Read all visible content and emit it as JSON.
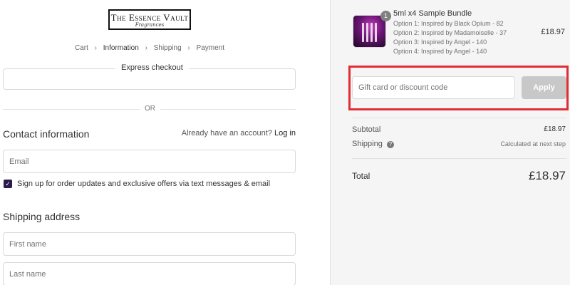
{
  "store": {
    "logo_title": "The Essence Vault",
    "logo_sub": "Fragrances"
  },
  "breadcrumb": {
    "items": [
      "Cart",
      "Information",
      "Shipping",
      "Payment"
    ],
    "current": "Information"
  },
  "express": {
    "label": "Express checkout"
  },
  "divider": {
    "or": "OR"
  },
  "contact": {
    "title": "Contact information",
    "account_prompt": "Already have an account?",
    "login_label": "Log in",
    "email_placeholder": "Email",
    "signup_label": "Sign up for order updates and exclusive offers via text messages & email",
    "signup_checked": true
  },
  "shipping": {
    "title": "Shipping address",
    "first_name_placeholder": "First name",
    "last_name_placeholder": "Last name"
  },
  "order": {
    "quantity": "1",
    "product_name": "5ml x4 Sample Bundle",
    "options": [
      "Option 1: Inspired by Black Opium - 82",
      "Option 2: Inspired by Madamoiselle - 37",
      "Option 3: Inspired by Angel - 140",
      "Option 4: Inspired by Angel - 140"
    ],
    "price": "£18.97"
  },
  "discount": {
    "placeholder": "Gift card or discount code",
    "apply_label": "Apply"
  },
  "summary": {
    "subtotal_label": "Subtotal",
    "subtotal_value": "£18.97",
    "shipping_label": "Shipping",
    "shipping_value": "Calculated at next step",
    "total_label": "Total",
    "total_value": "£18.97"
  },
  "colors": {
    "highlight": "#e02d36",
    "checkbox": "#2c1a4a",
    "apply_button": "#c8c8c8"
  }
}
